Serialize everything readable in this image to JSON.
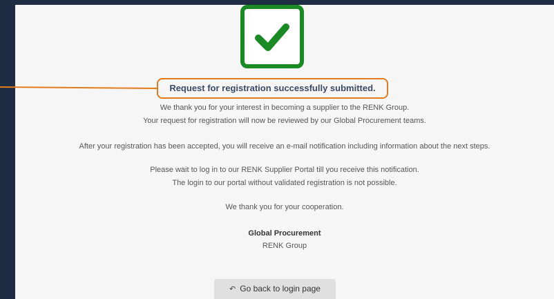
{
  "title": "Request for registration successfully submitted.",
  "lines": {
    "thanks_interest": "We thank you for your interest in becoming a supplier to the RENK Group.",
    "review": "Your request for registration will now be reviewed by our Global Procurement teams.",
    "after_accept": "After your registration has been accepted, you will receive an e-mail notification including information about the next steps.",
    "wait": "Please wait to log in to our RENK Supplier Portal till you receive this notification.",
    "not_possible": "The login to our portal without validated registration is not possible.",
    "cooperation": "We thank you for your cooperation."
  },
  "signature": {
    "department": "Global Procurement",
    "company": "RENK Group"
  },
  "back_button": {
    "label": "Go back to login page",
    "icon": "reply-arrow-icon"
  },
  "colors": {
    "success_green": "#1a8a24",
    "highlight_orange": "#e37a1c",
    "background_navy": "#1f2d44"
  },
  "icons": {
    "success": "checkmark-icon"
  }
}
